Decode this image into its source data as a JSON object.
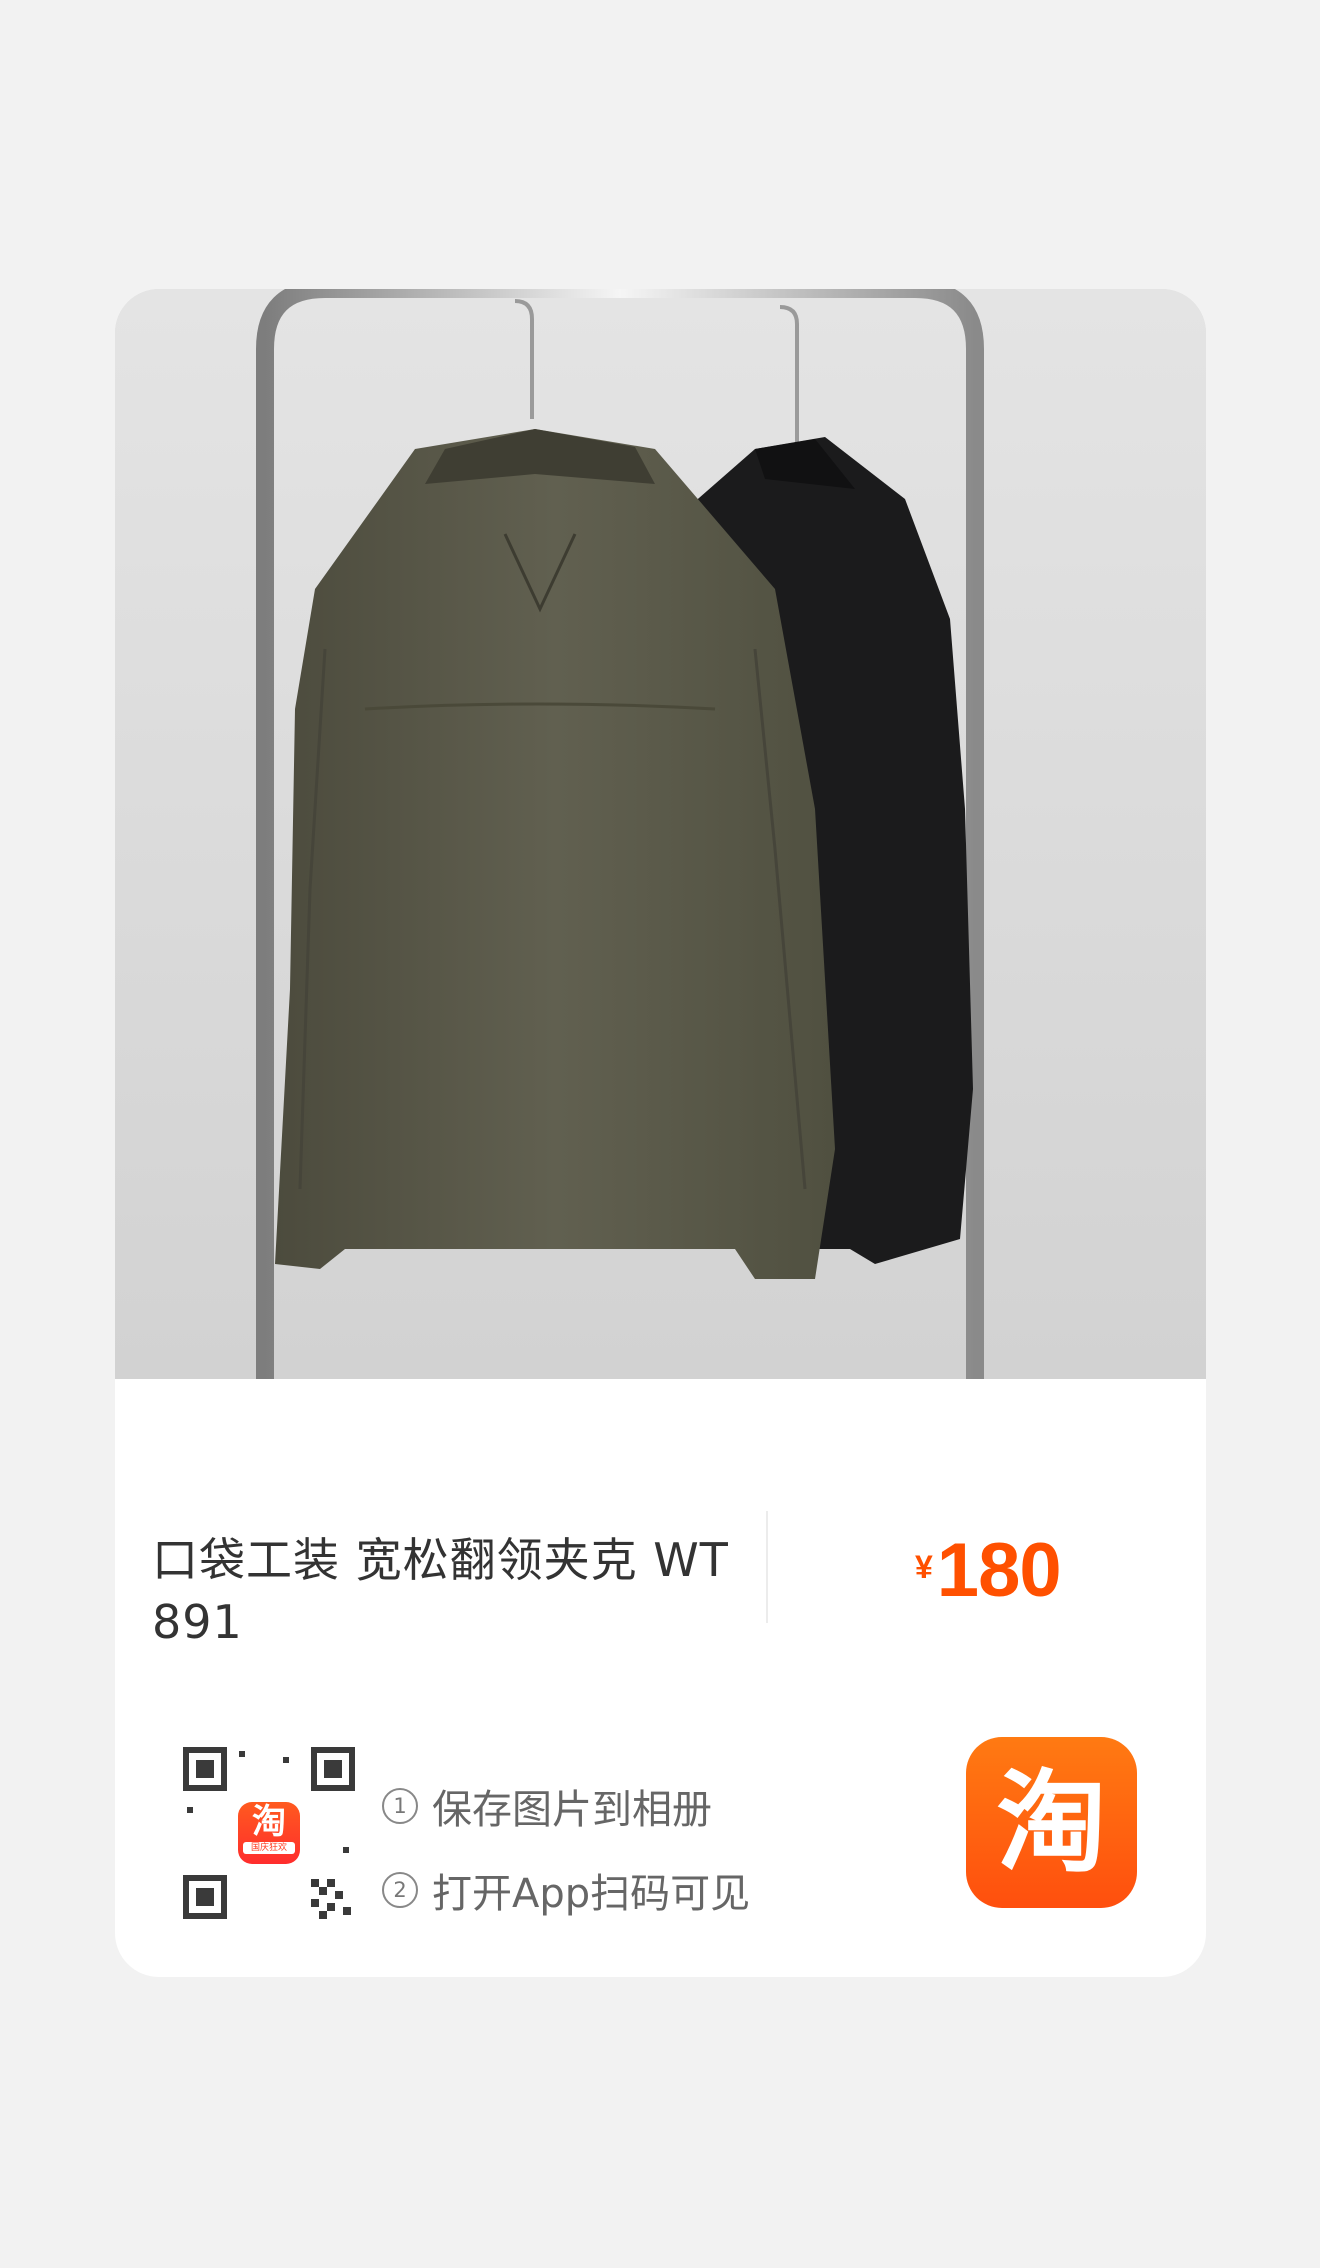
{
  "product": {
    "title": "口袋工装 宽松翻领夹克 WT891",
    "price_currency": "¥",
    "price_amount": "180",
    "image_alt": "Two jackets, olive and black, hanging on a chrome clothes rack"
  },
  "share": {
    "qr_badge_glyph": "淘",
    "qr_badge_caption": "国庆狂欢",
    "steps": [
      {
        "num": "1",
        "text": "保存图片到相册"
      },
      {
        "num": "2",
        "text": "打开App扫码可见"
      }
    ],
    "app_icon_glyph": "淘"
  },
  "colors": {
    "price": "#ff5000",
    "app_icon": "#ff5a0e",
    "background": "#f2f2f2"
  }
}
